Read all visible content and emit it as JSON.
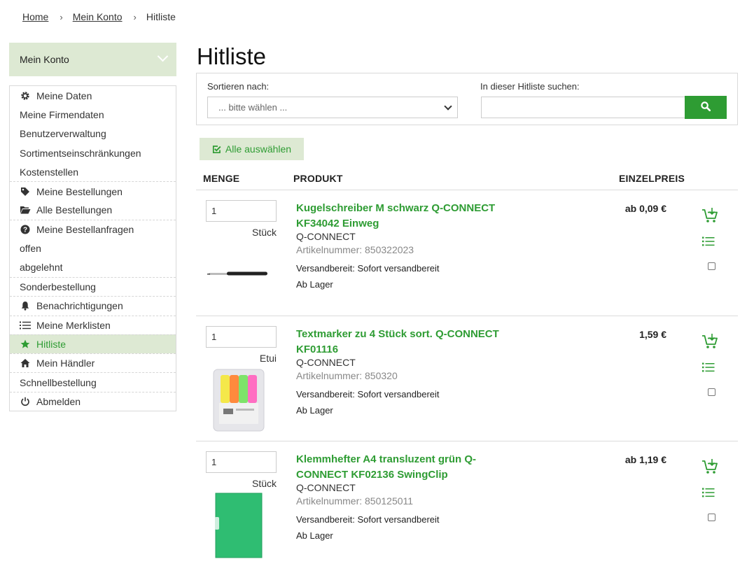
{
  "breadcrumb": {
    "home": "Home",
    "account": "Mein Konto",
    "current": "Hitliste"
  },
  "sidebar": {
    "header": "Mein Konto",
    "items": [
      {
        "label": "Meine Daten",
        "icon": "gear-icon"
      },
      {
        "label": "Meine Firmendaten",
        "icon": ""
      },
      {
        "label": "Benutzerverwaltung",
        "icon": ""
      },
      {
        "label": "Sortimentseinschränkungen",
        "icon": ""
      },
      {
        "label": "Kostenstellen",
        "icon": ""
      },
      {
        "label": "Meine Bestellungen",
        "icon": "tag-icon"
      },
      {
        "label": "Alle Bestellungen",
        "icon": "folder-open-icon"
      },
      {
        "label": "Meine Bestellanfragen",
        "icon": "question-circle-icon"
      },
      {
        "label": "offen",
        "icon": ""
      },
      {
        "label": "abgelehnt",
        "icon": ""
      },
      {
        "label": "Sonderbestellung",
        "icon": ""
      },
      {
        "label": "Benachrichtigungen",
        "icon": "bell-icon"
      },
      {
        "label": "Meine Merklisten",
        "icon": "list-icon"
      },
      {
        "label": "Hitliste",
        "icon": "star-icon",
        "active": true
      },
      {
        "label": "Mein Händler",
        "icon": "home-icon"
      },
      {
        "label": "Schnellbestellung",
        "icon": ""
      },
      {
        "label": "Abmelden",
        "icon": "power-icon"
      }
    ]
  },
  "main": {
    "title": "Hitliste",
    "sort_label": "Sortieren nach:",
    "sort_value": "... bitte wählen ...",
    "search_label": "In dieser Hitliste suchen:",
    "search_value": "",
    "select_all": "Alle auswählen",
    "columns": {
      "qty": "MENGE",
      "product": "PRODUKT",
      "price": "EINZELPREIS"
    }
  },
  "products": [
    {
      "qty": "1",
      "unit": "Stück",
      "name": "Kugelschreiber M schwarz Q-CONNECT KF34042 Einweg",
      "brand": "Q-CONNECT",
      "artnr": "Artikelnummer: 850322023",
      "shipping": "Versandbereit: Sofort versandbereit",
      "stock": "Ab Lager",
      "price": "ab 0,09 €"
    },
    {
      "qty": "1",
      "unit": "Etui",
      "name": "Textmarker zu 4 Stück sort. Q-CONNECT KF01116",
      "brand": "Q-CONNECT",
      "artnr": "Artikelnummer: 850320",
      "shipping": "Versandbereit: Sofort versandbereit",
      "stock": "Ab Lager",
      "price": "1,59 €"
    },
    {
      "qty": "1",
      "unit": "Stück",
      "name": "Klemmhefter A4 transluzent grün Q-CONNECT KF02136 SwingClip",
      "brand": "Q-CONNECT",
      "artnr": "Artikelnummer: 850125011",
      "shipping": "Versandbereit: Sofort versandbereit",
      "stock": "Ab Lager",
      "price": "ab 1,19 €"
    }
  ],
  "colors": {
    "accent": "#2e9c33",
    "accent_light": "#dde9d3",
    "border": "#d9d9d9"
  }
}
